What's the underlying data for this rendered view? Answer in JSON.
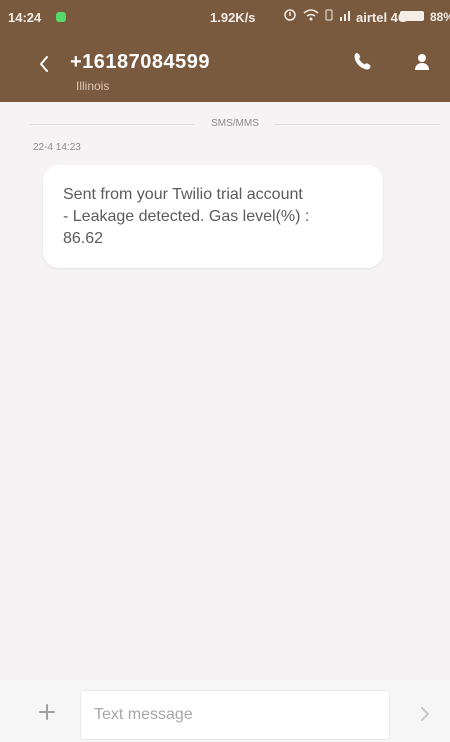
{
  "status": {
    "time": "14:24",
    "speed": "1.92K/s",
    "carrier": "airtel 4G",
    "battery_text": "88%"
  },
  "header": {
    "contact": "+16187084599",
    "location": "Illinois"
  },
  "conversation": {
    "channel": "SMS/MMS",
    "timestamp": "22-4 14:23",
    "message": "Sent from your Twilio trial account\n- Leakage detected. Gas level(%) :\n86.62"
  },
  "composer": {
    "placeholder": "Text message"
  },
  "icons": {
    "back": "chevron-left-icon",
    "call": "phone-icon",
    "contact": "person-icon",
    "attach": "plus-icon",
    "send": "chevron-right-icon"
  },
  "colors": {
    "header_bg": "#7a5a3e",
    "page_bg": "#f5f3f4",
    "bubble_bg": "#ffffff",
    "status_dot": "#56d86a"
  }
}
